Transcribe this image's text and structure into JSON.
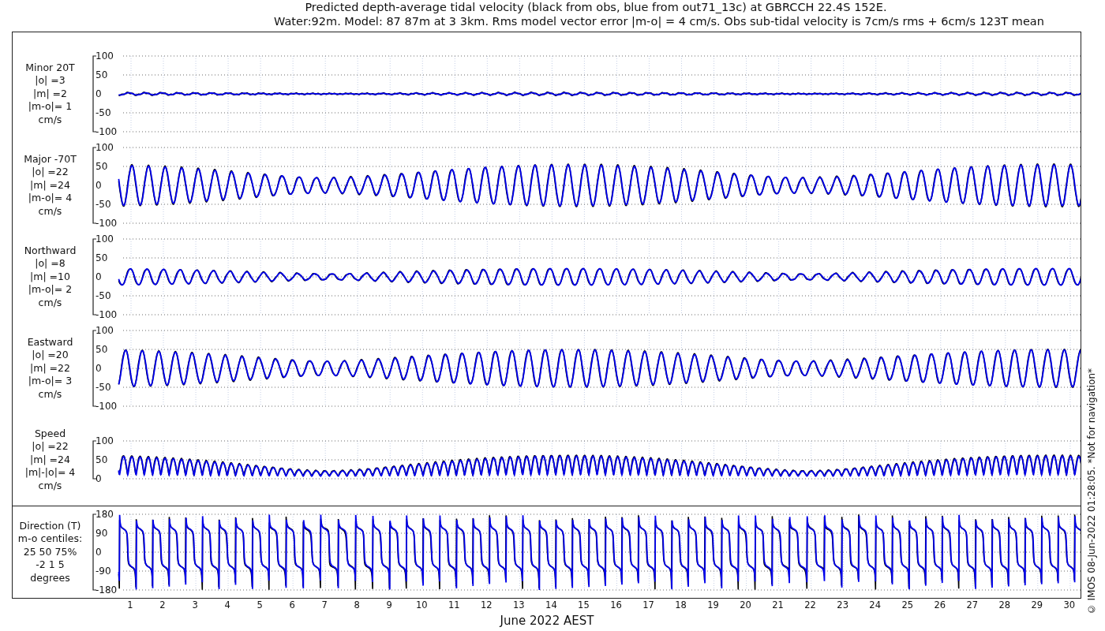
{
  "title": [
    "Predicted depth-average tidal velocity (black from obs, blue from out71_13c) at GBRCCH 22.4S 152E.",
    "Water:92m. Model: 87 87m at 3 3km. Rms model vector error |m-o| = 4 cm/s. Obs sub-tidal velocity is 7cm/s rms + 6cm/s 123T mean"
  ],
  "panels": [
    {
      "kind": "velocity",
      "label": [
        "Minor 20T",
        "|o| =3",
        "|m| =2",
        "|m-o|= 1",
        "cm/s"
      ],
      "yticks": [
        "100",
        "50",
        "0",
        "-50",
        "-100"
      ]
    },
    {
      "kind": "velocity",
      "label": [
        "Major -70T",
        "|o| =22",
        "|m| =24",
        "|m-o|= 4",
        "cm/s"
      ],
      "yticks": [
        "100",
        "50",
        "0",
        "-50",
        "-100"
      ]
    },
    {
      "kind": "velocity",
      "label": [
        "Northward",
        "|o| =8",
        "|m| =10",
        "|m-o|= 2",
        "cm/s"
      ],
      "yticks": [
        "100",
        "50",
        "0",
        "-50",
        "-100"
      ]
    },
    {
      "kind": "velocity",
      "label": [
        "Eastward",
        "|o| =20",
        "|m| =22",
        "|m-o|= 3",
        "cm/s"
      ],
      "yticks": [
        "100",
        "50",
        "0",
        "-50",
        "-100"
      ]
    },
    {
      "kind": "speed",
      "label": [
        "Speed",
        "|o| =22",
        "|m| =24",
        "|m|-|o|= 4",
        "cm/s"
      ],
      "yticks": [
        "100",
        "50",
        "0"
      ]
    },
    {
      "kind": "direction",
      "label": [
        "Direction (T)",
        "m-o centiles:",
        "25  50  75%",
        "-2  1  5",
        "degrees"
      ],
      "yticks": [
        "180",
        "90",
        "0",
        "-90",
        "-180"
      ]
    }
  ],
  "xticks": [
    "1",
    "2",
    "3",
    "4",
    "5",
    "6",
    "7",
    "8",
    "9",
    "10",
    "11",
    "12",
    "13",
    "14",
    "15",
    "16",
    "17",
    "18",
    "19",
    "20",
    "21",
    "22",
    "23",
    "24",
    "25",
    "26",
    "27",
    "28",
    "29",
    "30"
  ],
  "xlabel": "June 2022 AEST",
  "credit": "© IMOS 08-Jun-2022 01:28:05. *Not for navigation*"
}
